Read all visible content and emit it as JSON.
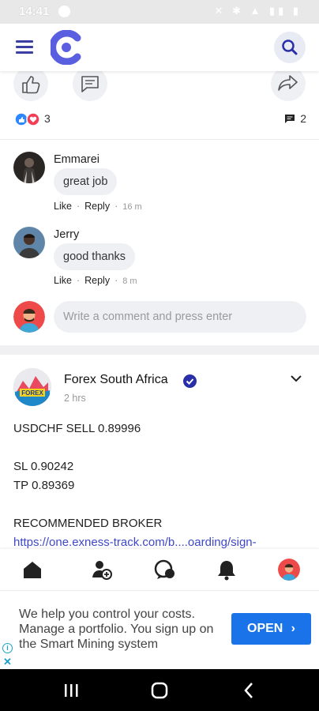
{
  "status_bar": {
    "time": "14:41"
  },
  "post_stats": {
    "reaction_count": "3",
    "comment_count": "2"
  },
  "comments": [
    {
      "name": "Emmarei",
      "text": "great job",
      "like": "Like",
      "reply": "Reply",
      "time": "16 m"
    },
    {
      "name": "Jerry",
      "text": "good thanks",
      "like": "Like",
      "reply": "Reply",
      "time": "8 m"
    }
  ],
  "comment_input": {
    "placeholder": "Write a comment and press enter"
  },
  "post": {
    "author": "Forex South Africa",
    "time": "2 hrs",
    "line1": "USDCHF SELL 0.89996",
    "line2": "SL 0.90242",
    "line3": "TP 0.89369",
    "line4": "RECOMMENDED BROKER",
    "link": "https://one.exness-track.com/b....oarding/sign-"
  },
  "ad": {
    "text": "We help you control your costs. Manage a portfolio. You sign up on the Smart Mining system",
    "button_label": "OPEN"
  },
  "colors": {
    "brand": "#5a5fe0",
    "accent": "#2a2fa8",
    "link": "#3e48c8",
    "ad_button": "#1a73e8"
  },
  "icons": [
    "menu-icon",
    "app-logo",
    "search-icon",
    "thumbs-up-icon",
    "comment-icon",
    "share-icon",
    "home-icon",
    "friends-icon",
    "messages-icon",
    "bell-icon",
    "chevron-down-icon",
    "verified-icon"
  ]
}
